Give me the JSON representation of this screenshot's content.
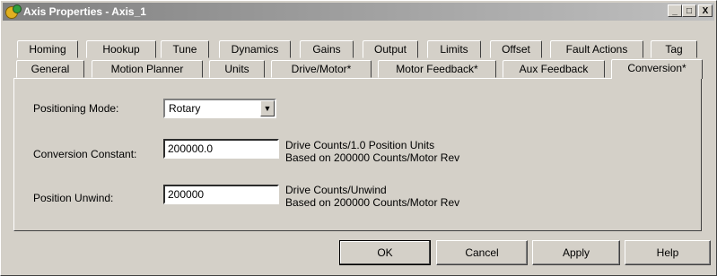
{
  "window": {
    "title": "Axis Properties - Axis_1",
    "minimize_glyph": "_",
    "maximize_glyph": "□",
    "close_glyph": "X"
  },
  "tabs_row1": [
    "Homing",
    "Hookup",
    "Tune",
    "Dynamics",
    "Gains",
    "Output",
    "Limits",
    "Offset",
    "Fault Actions",
    "Tag"
  ],
  "tabs_row2": [
    "General",
    "Motion Planner",
    "Units",
    "Drive/Motor*",
    "Motor Feedback*",
    "Aux Feedback",
    "Conversion*"
  ],
  "active_tab": "Conversion*",
  "conversion": {
    "positioning_mode_label": "Positioning Mode:",
    "positioning_mode_value": "Rotary",
    "conversion_constant_label": "Conversion Constant:",
    "conversion_constant_value": "200000.0",
    "conversion_desc_line1": "Drive Counts/1.0 Position Units",
    "conversion_desc_line2": "Based on 200000 Counts/Motor Rev",
    "position_unwind_label": "Position Unwind:",
    "position_unwind_value": "200000",
    "unwind_desc_line1": "Drive Counts/Unwind",
    "unwind_desc_line2": "Based on 200000 Counts/Motor Rev"
  },
  "buttons": {
    "ok": "OK",
    "cancel": "Cancel",
    "apply": "Apply",
    "help": "Help"
  }
}
